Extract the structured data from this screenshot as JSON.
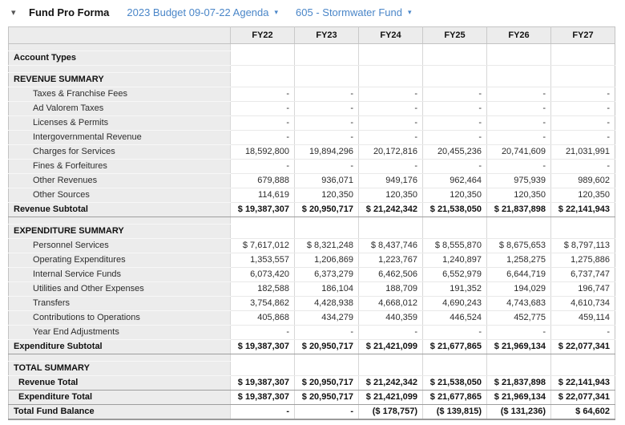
{
  "header": {
    "collapse_icon": "▾",
    "title": "Fund Pro Forma",
    "budget_dropdown_label": "2023 Budget 09-07-22 Agenda",
    "fund_dropdown_label": "605 - Stormwater Fund",
    "dropdown_caret": "▾",
    "link_color": "#4a86c8"
  },
  "table": {
    "columns": [
      "FY22",
      "FY23",
      "FY24",
      "FY25",
      "FY26",
      "FY27"
    ],
    "rows": [
      {
        "type": "spacer",
        "label": "",
        "values": [
          "",
          "",
          "",
          "",
          "",
          ""
        ]
      },
      {
        "type": "section",
        "label": "Account Types",
        "values": [
          "",
          "",
          "",
          "",
          "",
          ""
        ]
      },
      {
        "type": "spacer",
        "label": "",
        "values": [
          "",
          "",
          "",
          "",
          "",
          ""
        ]
      },
      {
        "type": "section",
        "label": "REVENUE SUMMARY",
        "values": [
          "",
          "",
          "",
          "",
          "",
          ""
        ]
      },
      {
        "type": "detail",
        "label": "Taxes & Franchise Fees",
        "values": [
          "-",
          "-",
          "-",
          "-",
          "-",
          "-"
        ]
      },
      {
        "type": "detail",
        "label": "Ad Valorem Taxes",
        "values": [
          "-",
          "-",
          "-",
          "-",
          "-",
          "-"
        ]
      },
      {
        "type": "detail",
        "label": "Licenses & Permits",
        "values": [
          "-",
          "-",
          "-",
          "-",
          "-",
          "-"
        ]
      },
      {
        "type": "detail",
        "label": "Intergovernmental Revenue",
        "values": [
          "-",
          "-",
          "-",
          "-",
          "-",
          "-"
        ]
      },
      {
        "type": "detail",
        "label": "Charges for Services",
        "values": [
          "18,592,800",
          "19,894,296",
          "20,172,816",
          "20,455,236",
          "20,741,609",
          "21,031,991"
        ]
      },
      {
        "type": "detail",
        "label": "Fines & Forfeitures",
        "values": [
          "-",
          "-",
          "-",
          "-",
          "-",
          "-"
        ]
      },
      {
        "type": "detail",
        "label": "Other Revenues",
        "values": [
          "679,888",
          "936,071",
          "949,176",
          "962,464",
          "975,939",
          "989,602"
        ]
      },
      {
        "type": "detail",
        "label": "Other Sources",
        "values": [
          "114,619",
          "120,350",
          "120,350",
          "120,350",
          "120,350",
          "120,350"
        ]
      },
      {
        "type": "framed",
        "label": "Revenue Subtotal",
        "values": [
          "$ 19,387,307",
          "$ 20,950,717",
          "$ 21,242,342",
          "$ 21,538,050",
          "$ 21,837,898",
          "$ 22,141,943"
        ]
      },
      {
        "type": "spacer",
        "label": "",
        "values": [
          "",
          "",
          "",
          "",
          "",
          ""
        ]
      },
      {
        "type": "section",
        "label": "EXPENDITURE SUMMARY",
        "values": [
          "",
          "",
          "",
          "",
          "",
          ""
        ]
      },
      {
        "type": "detail",
        "label": "Personnel Services",
        "values": [
          "$ 7,617,012",
          "$ 8,321,248",
          "$ 8,437,746",
          "$ 8,555,870",
          "$ 8,675,653",
          "$ 8,797,113"
        ]
      },
      {
        "type": "detail",
        "label": "Operating Expenditures",
        "values": [
          "1,353,557",
          "1,206,869",
          "1,223,767",
          "1,240,897",
          "1,258,275",
          "1,275,886"
        ]
      },
      {
        "type": "detail",
        "label": "Internal Service Funds",
        "values": [
          "6,073,420",
          "6,373,279",
          "6,462,506",
          "6,552,979",
          "6,644,719",
          "6,737,747"
        ]
      },
      {
        "type": "detail",
        "label": "Utilities and Other Expenses",
        "values": [
          "182,588",
          "186,104",
          "188,709",
          "191,352",
          "194,029",
          "196,747"
        ]
      },
      {
        "type": "detail",
        "label": "Transfers",
        "values": [
          "3,754,862",
          "4,428,938",
          "4,668,012",
          "4,690,243",
          "4,743,683",
          "4,610,734"
        ]
      },
      {
        "type": "detail",
        "label": "Contributions to Operations",
        "values": [
          "405,868",
          "434,279",
          "440,359",
          "446,524",
          "452,775",
          "459,114"
        ]
      },
      {
        "type": "detail",
        "label": "Year End Adjustments",
        "values": [
          "-",
          "-",
          "-",
          "-",
          "-",
          "-"
        ]
      },
      {
        "type": "framed",
        "label": "Expenditure Subtotal",
        "values": [
          "$ 19,387,307",
          "$ 20,950,717",
          "$ 21,421,099",
          "$ 21,677,865",
          "$ 21,969,134",
          "$ 22,077,341"
        ]
      },
      {
        "type": "spacer",
        "label": "",
        "values": [
          "",
          "",
          "",
          "",
          "",
          ""
        ]
      },
      {
        "type": "section",
        "label": "TOTAL SUMMARY",
        "values": [
          "",
          "",
          "",
          "",
          "",
          ""
        ]
      },
      {
        "type": "framed total-line",
        "label": "Revenue Total",
        "values": [
          "$ 19,387,307",
          "$ 20,950,717",
          "$ 21,242,342",
          "$ 21,538,050",
          "$ 21,837,898",
          "$ 22,141,943"
        ]
      },
      {
        "type": "framed total-line",
        "label": "Expenditure Total",
        "values": [
          "$ 19,387,307",
          "$ 20,950,717",
          "$ 21,421,099",
          "$ 21,677,865",
          "$ 21,969,134",
          "$ 22,077,341"
        ]
      },
      {
        "type": "framed",
        "label": "Total Fund Balance",
        "values": [
          "-",
          "-",
          "($ 178,757)",
          "($ 139,815)",
          "($ 131,236)",
          "$ 64,602"
        ]
      }
    ]
  }
}
